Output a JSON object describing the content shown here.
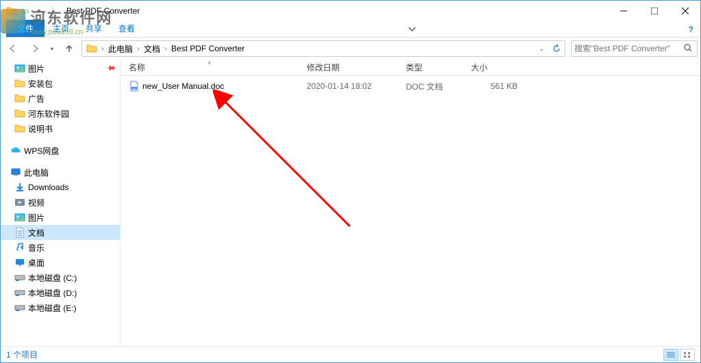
{
  "window": {
    "title": "Best PDF Converter"
  },
  "ribbon": {
    "file": "文件",
    "home": "主页",
    "share": "共享",
    "view": "查看"
  },
  "breadcrumb": {
    "pc": "此电脑",
    "docs": "文档",
    "folder": "Best PDF Converter"
  },
  "search": {
    "placeholder": "搜索\"Best PDF Converter\""
  },
  "sidebar": {
    "pictures": "图片",
    "install_pkg": "安装包",
    "ads": "广告",
    "hedong": "河东软件园",
    "manual": "说明书",
    "wps": "WPS网盘",
    "thispc": "此电脑",
    "downloads": "Downloads",
    "videos": "视频",
    "pics2": "图片",
    "docs": "文档",
    "music": "音乐",
    "desktop": "桌面",
    "disk_c": "本地磁盘 (C:)",
    "disk_d": "本地磁盘 (D:)",
    "disk_e": "本地磁盘 (E:)"
  },
  "columns": {
    "name": "名称",
    "date": "修改日期",
    "type": "类型",
    "size": "大小"
  },
  "files": [
    {
      "name": "new_User Manual.doc",
      "date": "2020-01-14 18:02",
      "type": "DOC 文档",
      "size": "561 KB"
    }
  ],
  "status": {
    "count": "1 个项目"
  },
  "watermark": {
    "name": "河东软件网",
    "url": "www.pc0359.cn"
  }
}
